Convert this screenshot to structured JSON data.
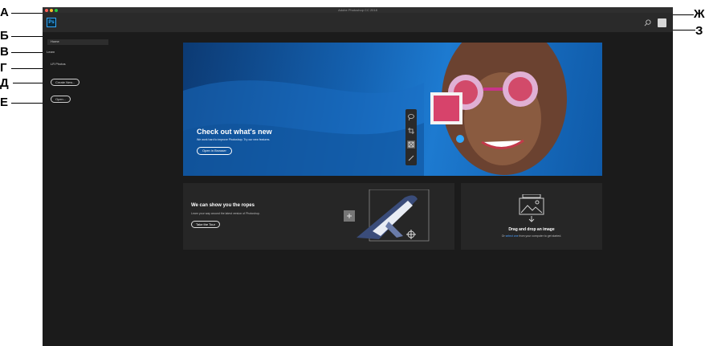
{
  "window": {
    "title": "Adobe Photoshop CC 2018"
  },
  "toolbar": {
    "logo_text": "Ps"
  },
  "sidebar": {
    "items": [
      {
        "label": "Home"
      },
      {
        "label": "Learn"
      },
      {
        "label": "LR Photos"
      }
    ],
    "create_new_label": "Create New...",
    "open_label": "Open..."
  },
  "hero": {
    "title": "Check out what's new",
    "subtitle": "We work hard to improve Photoshop. Try our new features.",
    "button_label": "Open in Browser"
  },
  "tour_card": {
    "title": "We can show you the ropes",
    "subtitle": "Learn your way around the latest version of Photoshop.",
    "button_label": "Take the Tour"
  },
  "drop_card": {
    "title": "Drag and drop an image",
    "subtitle_prefix": "Or",
    "subtitle_link": "select one",
    "subtitle_suffix": "from your computer to get started."
  },
  "callouts": {
    "a": "А",
    "b": "Б",
    "v": "В",
    "g": "Г",
    "d": "Д",
    "e": "Е",
    "zh": "Ж",
    "z": "З"
  },
  "colors": {
    "window_bg": "#1b1b1b",
    "toolbar_bg": "#2a2a2a",
    "accent": "#31a8ff",
    "hero_blue": "#1461b0",
    "link": "#4ea1ff"
  }
}
